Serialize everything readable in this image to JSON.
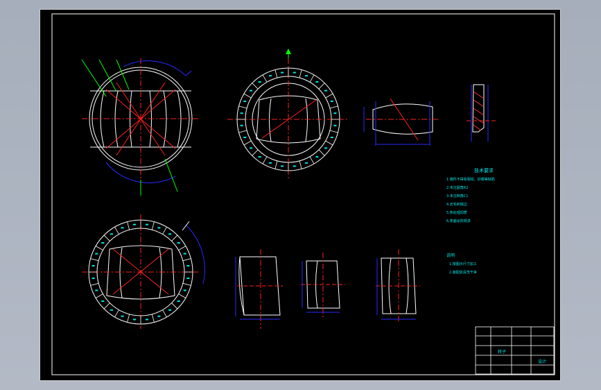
{
  "canvas": {
    "background": "#000000",
    "colors": {
      "outline": "#ffffff",
      "centerline": "#ff2020",
      "dimension": "#2a2aff",
      "text": "#00e5e5",
      "leader": "#00ff00",
      "hatch": "#ff3030",
      "frame": "#ffffff"
    }
  },
  "notes": {
    "heading": "技术要求",
    "items": [
      "1.铸件不得有裂纹、砂眼等缺陷",
      "2.未注圆角R2",
      "3.未注倒角C1",
      "4.去毛刺锐边",
      "5.热处理调质",
      "6.表面涂防锈漆"
    ],
    "section_heading": "说明",
    "section_items": [
      "1.按图示尺寸加工",
      "2.装配前清洗干净"
    ]
  },
  "title_block": {
    "drawing_name": "转子",
    "company": "设计"
  },
  "icons": [
    "north-arrow-icon"
  ]
}
